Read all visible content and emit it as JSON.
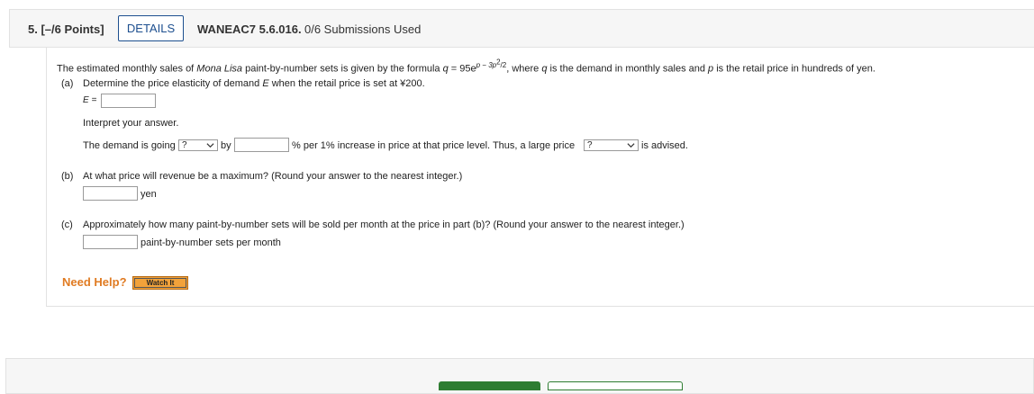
{
  "header": {
    "question_number": "5.  [–/6 Points]",
    "details_label": "DETAILS",
    "question_code": "WANEAC7 5.6.016.",
    "submissions": "0/6 Submissions Used"
  },
  "problem": {
    "intro_1": "The estimated monthly sales of ",
    "intro_italic": "Mona Lisa",
    "intro_2": " paint-by-number sets is given by the formula ",
    "formula_q": "q",
    "formula_eq": " = 95e",
    "formula_exp": "p − 3p",
    "formula_sq": "2",
    "formula_exp_end": "/2",
    "intro_3": ", where ",
    "var_q": "q",
    "intro_4": " is the demand in monthly sales and ",
    "var_p": "p",
    "intro_5": " is the retail price in hundreds of yen."
  },
  "part_a": {
    "label": "(a)",
    "question_1": "Determine the price elasticity of demand ",
    "var_E": "E",
    "question_2": " when the retail price is set at ¥200.",
    "e_label": "E =",
    "e_value": "",
    "interpret": "Interpret your answer.",
    "demand_text": "The demand is going",
    "select_1_value": "?",
    "by_text": "by",
    "pct_value": "",
    "pct_text": "% per 1% increase in price at that price level. Thus, a large price",
    "select_2_value": "?",
    "advised_text": "is advised."
  },
  "part_b": {
    "label": "(b)",
    "question": "At what price will revenue be a maximum? (Round your answer to the nearest integer.)",
    "value": "",
    "unit": "yen"
  },
  "part_c": {
    "label": "(c)",
    "question": "Approximately how many paint-by-number sets will be sold per month at the price in part (b)? (Round your answer to the nearest integer.)",
    "value": "",
    "unit": "paint-by-number sets per month"
  },
  "help": {
    "label": "Need Help?",
    "watch_label": "Watch It"
  },
  "icons": {
    "dropdown": "chevron-down-icon"
  }
}
